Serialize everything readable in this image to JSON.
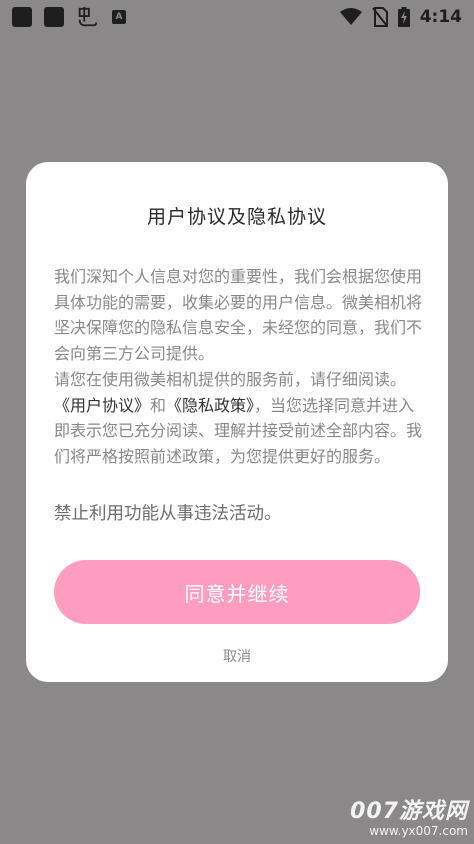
{
  "status_bar": {
    "time": "4:14",
    "notification_icons": [
      "square-icon",
      "square-icon",
      "bug-icon",
      "a-icon"
    ],
    "a_icon_text": "A",
    "right_icons": [
      "wifi-icon",
      "no-sim-icon",
      "battery-charging-icon"
    ]
  },
  "dialog": {
    "title": "用户协议及隐私协议",
    "paragraph1": "我们深知个人信息对您的重要性，我们会根据您使用具体功能的需要，收集必要的用户信息。微美相机将坚决保障您的隐私信息安全，未经您的同意，我们不会向第三方公司提供。",
    "paragraph2_prefix": "请您在使用微美相机提供的服务前，请仔细阅读。",
    "user_agreement_link": "《用户协议》",
    "conjunction": "和",
    "privacy_policy_link": "《隐私政策》",
    "paragraph2_suffix": "，当您选择同意并进入即表示您已充分阅读、理解并接受前述全部内容。我们将严格按照前述政策，为您提供更好的服务。",
    "paragraph3": "禁止利用功能从事违法活动。",
    "agree_button": "同意并继续",
    "cancel_button": "取消"
  },
  "watermark": {
    "main": "007游戏网",
    "url": "www.yx007.com"
  },
  "colors": {
    "overlay": "#8a8889",
    "dialog_bg": "#ffffff",
    "accent": "#ff9dc0",
    "body_text": "#888888"
  }
}
